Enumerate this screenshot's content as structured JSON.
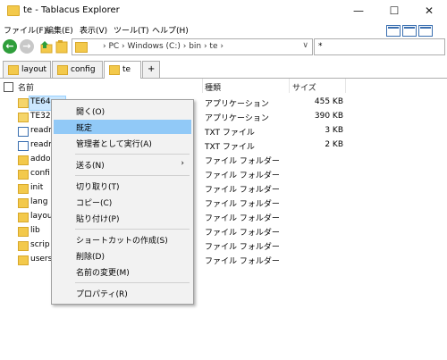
{
  "window": {
    "title": "te - Tablacus Explorer",
    "controls": [
      "—",
      "☐",
      "✕"
    ]
  },
  "menu": [
    "ファイル(F)",
    "編集(E)",
    "表示(V)",
    "ツール(T)",
    "ヘルプ(H)"
  ],
  "toolbar": {
    "back_icon": "back-arrow-icon",
    "forward_icon": "forward-arrow-icon",
    "address": "› PC › Windows (C:) › bin › te ›",
    "address_dropdown": "∨",
    "filter": "*"
  },
  "tabs": [
    {
      "label": "layout"
    },
    {
      "label": "config"
    },
    {
      "label": "te",
      "active": true
    }
  ],
  "tab_add": "+",
  "columns": {
    "name": "名前",
    "type": "種類",
    "size": "サイズ"
  },
  "rows": [
    {
      "name": "TE64",
      "type": "アプリケーション",
      "size": "455 KB",
      "icon": "app"
    },
    {
      "name": "TE32",
      "type": "アプリケーション",
      "size": "390 KB",
      "icon": "app"
    },
    {
      "name": "readm",
      "type": "TXT ファイル",
      "size": "3 KB",
      "icon": "txt"
    },
    {
      "name": "readm",
      "type": "TXT ファイル",
      "size": "2 KB",
      "icon": "txt"
    },
    {
      "name": "addo",
      "type": "ファイル フォルダー",
      "size": "",
      "icon": "folder"
    },
    {
      "name": "confi",
      "type": "ファイル フォルダー",
      "size": "",
      "icon": "folder"
    },
    {
      "name": "init",
      "type": "ファイル フォルダー",
      "size": "",
      "icon": "folder"
    },
    {
      "name": "lang",
      "type": "ファイル フォルダー",
      "size": "",
      "icon": "folder"
    },
    {
      "name": "layou",
      "type": "ファイル フォルダー",
      "size": "",
      "icon": "folder"
    },
    {
      "name": "lib",
      "type": "ファイル フォルダー",
      "size": "",
      "icon": "folder"
    },
    {
      "name": "scrip",
      "type": "ファイル フォルダー",
      "size": "",
      "icon": "folder"
    },
    {
      "name": "users",
      "type": "ファイル フォルダー",
      "size": "",
      "icon": "folder"
    }
  ],
  "context_menu": {
    "items": [
      "開く(O)",
      "既定",
      "管理者として実行(A)",
      "送る(N)",
      "切り取り(T)",
      "コピー(C)",
      "貼り付け(P)",
      "ショートカットの作成(S)",
      "削除(D)",
      "名前の変更(M)",
      "プロパティ(R)"
    ],
    "submenu_arrow": "›"
  }
}
